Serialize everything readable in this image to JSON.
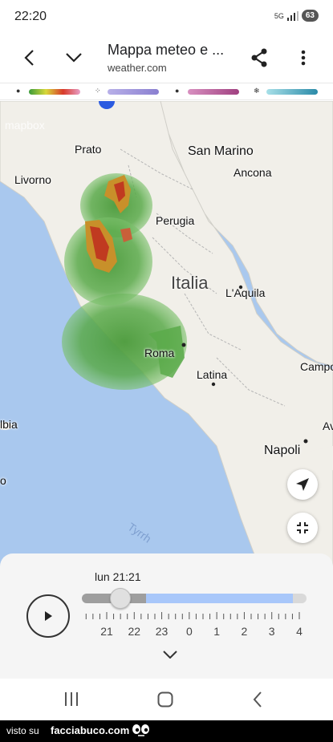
{
  "status": {
    "time": "22:20",
    "network": "5G",
    "battery": "63"
  },
  "header": {
    "title": "Mappa meteo e ...",
    "subtitle": "weather.com"
  },
  "legend": {
    "rain_colors": [
      "#3a9b3a",
      "#d8d83a",
      "#d83a2a"
    ],
    "mix_color": "#9a8fd8",
    "ice_color": "#c05a9a",
    "snow_color": "#4ab0c8"
  },
  "map": {
    "attribution": "mapbox",
    "labels": {
      "prato": "Prato",
      "san_marino": "San Marino",
      "ancona": "Ancona",
      "livorno": "Livorno",
      "perugia": "Perugia",
      "italia": "Italia",
      "laquila": "L'Aquila",
      "roma": "Roma",
      "latina": "Latina",
      "campo": "Campo",
      "elba": "lbia",
      "napoli": "Napoli",
      "av": "Av",
      "sea": "Tyrrh",
      "edge_o": "o"
    }
  },
  "timeline": {
    "current_time": "lun 21:21",
    "hours": [
      "21",
      "22",
      "23",
      "0",
      "1",
      "2",
      "3",
      "4"
    ],
    "progress_fraction": 0.16
  },
  "footer": {
    "visto": "visto su",
    "site": "facciabuco.com"
  }
}
